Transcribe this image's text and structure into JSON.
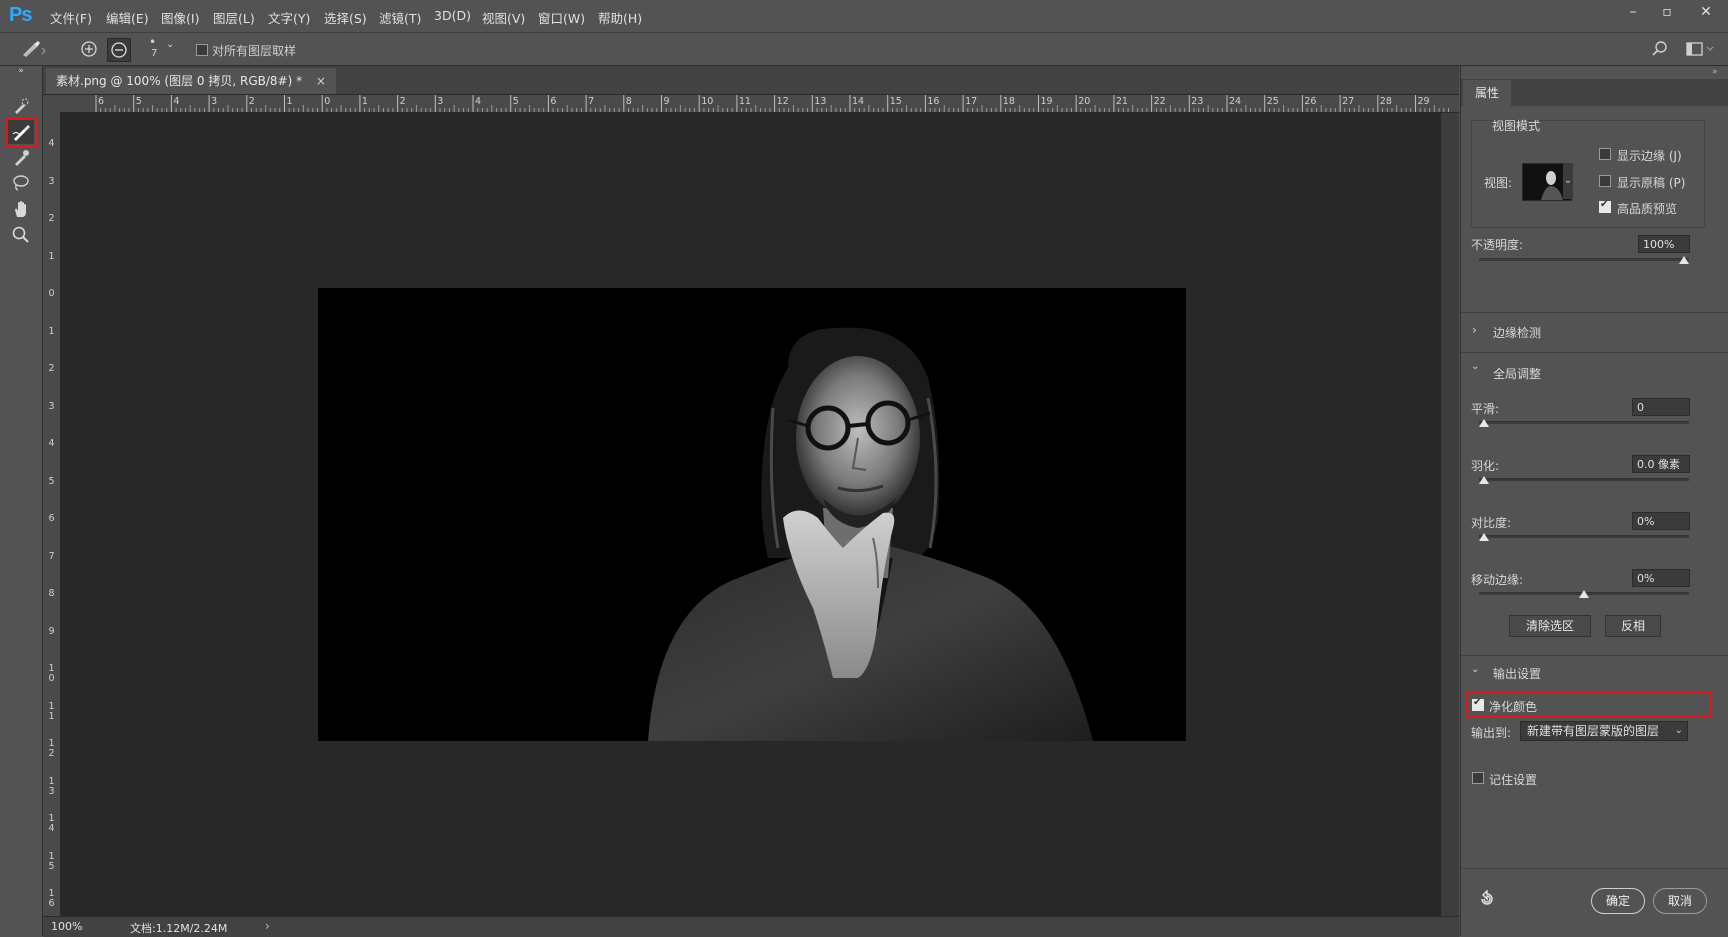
{
  "app": {
    "logo": "Ps"
  },
  "menu": [
    "文件(F)",
    "编辑(E)",
    "图像(I)",
    "图层(L)",
    "文字(Y)",
    "选择(S)",
    "滤镜(T)",
    "3D(D)",
    "视图(V)",
    "窗口(W)",
    "帮助(H)"
  ],
  "window_controls": {
    "minimize": "–",
    "restore": "▫",
    "close": "✕"
  },
  "options_bar": {
    "brush_size": "7",
    "sample_all_layers_label": "对所有图层取样",
    "sample_all_layers_checked": false
  },
  "document": {
    "tab_title": "素材.png @ 100% (图层 0 拷贝, RGB/8#) *",
    "close": "×",
    "ruler_top": [
      "6",
      "5",
      "4",
      "3",
      "2",
      "1",
      "0",
      "1",
      "2",
      "3",
      "4",
      "5",
      "6",
      "7",
      "8",
      "9",
      "10",
      "11",
      "12",
      "13",
      "14",
      "15",
      "16",
      "17",
      "18",
      "19",
      "20",
      "21",
      "22",
      "23",
      "24",
      "25",
      "26",
      "27",
      "28",
      "29"
    ],
    "ruler_left": [
      "4",
      "3",
      "2",
      "1",
      "0",
      "1",
      "2",
      "3",
      "4",
      "5",
      "6",
      "7",
      "8",
      "9",
      "10",
      "11",
      "12",
      "13",
      "14",
      "15",
      "16"
    ]
  },
  "status": {
    "zoom": "100%",
    "doc_info": "文档:1.12M/2.24M",
    "arrow": "›"
  },
  "panel": {
    "tab": "属性",
    "view_mode": {
      "title": "视图模式",
      "view_label": "视图:",
      "show_edge_label": "显示边缘 (J)",
      "show_edge_checked": false,
      "show_original_label": "显示原稿 (P)",
      "show_original_checked": false,
      "hq_preview_label": "高品质预览",
      "hq_preview_checked": true
    },
    "opacity": {
      "label": "不透明度:",
      "value": "100%",
      "level": 1.0
    },
    "edge_detection": {
      "title": "边缘检测"
    },
    "global": {
      "title": "全局调整",
      "smooth": {
        "label": "平滑:",
        "value": "0",
        "level": 0.0
      },
      "feather": {
        "label": "羽化:",
        "value": "0.0 像素",
        "level": 0.0
      },
      "contrast": {
        "label": "对比度:",
        "value": "0%",
        "level": 0.0
      },
      "shift_edge": {
        "label": "移动边缘:",
        "value": "0%",
        "level": 0.5
      },
      "clear_selection": "清除选区",
      "invert": "反相"
    },
    "output": {
      "title": "输出设置",
      "decontaminate_label": "净化颜色",
      "decontaminate_checked": true,
      "output_to_label": "输出到:",
      "output_to_value": "新建带有图层蒙版的图层",
      "remember_label": "记住设置",
      "remember_checked": false
    },
    "ok": "确定",
    "cancel": "取消"
  },
  "colors": {
    "accent_logo": "#31a8ff",
    "highlight_box": "#e0191e",
    "canvas_bg": "#282828",
    "ui_bg": "#535353"
  }
}
